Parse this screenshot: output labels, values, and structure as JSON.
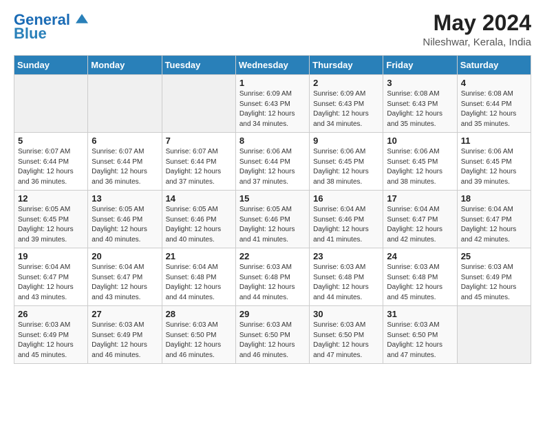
{
  "header": {
    "logo_general": "General",
    "logo_blue": "Blue",
    "title": "May 2024",
    "subtitle": "Nileshwar, Kerala, India"
  },
  "days_of_week": [
    "Sunday",
    "Monday",
    "Tuesday",
    "Wednesday",
    "Thursday",
    "Friday",
    "Saturday"
  ],
  "weeks": [
    [
      {
        "day": "",
        "info": ""
      },
      {
        "day": "",
        "info": ""
      },
      {
        "day": "",
        "info": ""
      },
      {
        "day": "1",
        "info": "Sunrise: 6:09 AM\nSunset: 6:43 PM\nDaylight: 12 hours\nand 34 minutes."
      },
      {
        "day": "2",
        "info": "Sunrise: 6:09 AM\nSunset: 6:43 PM\nDaylight: 12 hours\nand 34 minutes."
      },
      {
        "day": "3",
        "info": "Sunrise: 6:08 AM\nSunset: 6:43 PM\nDaylight: 12 hours\nand 35 minutes."
      },
      {
        "day": "4",
        "info": "Sunrise: 6:08 AM\nSunset: 6:44 PM\nDaylight: 12 hours\nand 35 minutes."
      }
    ],
    [
      {
        "day": "5",
        "info": "Sunrise: 6:07 AM\nSunset: 6:44 PM\nDaylight: 12 hours\nand 36 minutes."
      },
      {
        "day": "6",
        "info": "Sunrise: 6:07 AM\nSunset: 6:44 PM\nDaylight: 12 hours\nand 36 minutes."
      },
      {
        "day": "7",
        "info": "Sunrise: 6:07 AM\nSunset: 6:44 PM\nDaylight: 12 hours\nand 37 minutes."
      },
      {
        "day": "8",
        "info": "Sunrise: 6:06 AM\nSunset: 6:44 PM\nDaylight: 12 hours\nand 37 minutes."
      },
      {
        "day": "9",
        "info": "Sunrise: 6:06 AM\nSunset: 6:45 PM\nDaylight: 12 hours\nand 38 minutes."
      },
      {
        "day": "10",
        "info": "Sunrise: 6:06 AM\nSunset: 6:45 PM\nDaylight: 12 hours\nand 38 minutes."
      },
      {
        "day": "11",
        "info": "Sunrise: 6:06 AM\nSunset: 6:45 PM\nDaylight: 12 hours\nand 39 minutes."
      }
    ],
    [
      {
        "day": "12",
        "info": "Sunrise: 6:05 AM\nSunset: 6:45 PM\nDaylight: 12 hours\nand 39 minutes."
      },
      {
        "day": "13",
        "info": "Sunrise: 6:05 AM\nSunset: 6:46 PM\nDaylight: 12 hours\nand 40 minutes."
      },
      {
        "day": "14",
        "info": "Sunrise: 6:05 AM\nSunset: 6:46 PM\nDaylight: 12 hours\nand 40 minutes."
      },
      {
        "day": "15",
        "info": "Sunrise: 6:05 AM\nSunset: 6:46 PM\nDaylight: 12 hours\nand 41 minutes."
      },
      {
        "day": "16",
        "info": "Sunrise: 6:04 AM\nSunset: 6:46 PM\nDaylight: 12 hours\nand 41 minutes."
      },
      {
        "day": "17",
        "info": "Sunrise: 6:04 AM\nSunset: 6:47 PM\nDaylight: 12 hours\nand 42 minutes."
      },
      {
        "day": "18",
        "info": "Sunrise: 6:04 AM\nSunset: 6:47 PM\nDaylight: 12 hours\nand 42 minutes."
      }
    ],
    [
      {
        "day": "19",
        "info": "Sunrise: 6:04 AM\nSunset: 6:47 PM\nDaylight: 12 hours\nand 43 minutes."
      },
      {
        "day": "20",
        "info": "Sunrise: 6:04 AM\nSunset: 6:47 PM\nDaylight: 12 hours\nand 43 minutes."
      },
      {
        "day": "21",
        "info": "Sunrise: 6:04 AM\nSunset: 6:48 PM\nDaylight: 12 hours\nand 44 minutes."
      },
      {
        "day": "22",
        "info": "Sunrise: 6:03 AM\nSunset: 6:48 PM\nDaylight: 12 hours\nand 44 minutes."
      },
      {
        "day": "23",
        "info": "Sunrise: 6:03 AM\nSunset: 6:48 PM\nDaylight: 12 hours\nand 44 minutes."
      },
      {
        "day": "24",
        "info": "Sunrise: 6:03 AM\nSunset: 6:48 PM\nDaylight: 12 hours\nand 45 minutes."
      },
      {
        "day": "25",
        "info": "Sunrise: 6:03 AM\nSunset: 6:49 PM\nDaylight: 12 hours\nand 45 minutes."
      }
    ],
    [
      {
        "day": "26",
        "info": "Sunrise: 6:03 AM\nSunset: 6:49 PM\nDaylight: 12 hours\nand 45 minutes."
      },
      {
        "day": "27",
        "info": "Sunrise: 6:03 AM\nSunset: 6:49 PM\nDaylight: 12 hours\nand 46 minutes."
      },
      {
        "day": "28",
        "info": "Sunrise: 6:03 AM\nSunset: 6:50 PM\nDaylight: 12 hours\nand 46 minutes."
      },
      {
        "day": "29",
        "info": "Sunrise: 6:03 AM\nSunset: 6:50 PM\nDaylight: 12 hours\nand 46 minutes."
      },
      {
        "day": "30",
        "info": "Sunrise: 6:03 AM\nSunset: 6:50 PM\nDaylight: 12 hours\nand 47 minutes."
      },
      {
        "day": "31",
        "info": "Sunrise: 6:03 AM\nSunset: 6:50 PM\nDaylight: 12 hours\nand 47 minutes."
      },
      {
        "day": "",
        "info": ""
      }
    ]
  ]
}
